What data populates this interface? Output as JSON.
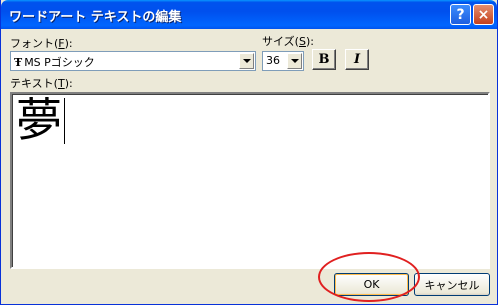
{
  "window": {
    "title": "ワードアート テキストの編集",
    "help_glyph": "?",
    "close_glyph": "×"
  },
  "font": {
    "label_prefix": "フォント(",
    "label_key": "F",
    "label_suffix": "):",
    "value": "MS Pゴシック",
    "icon_glyph": "Ŧ"
  },
  "size": {
    "label_prefix": "サイズ(",
    "label_key": "S",
    "label_suffix": "):",
    "value": "36"
  },
  "format": {
    "bold_label": "B",
    "italic_label": "I"
  },
  "text": {
    "label_prefix": "テキスト(",
    "label_key": "T",
    "label_suffix": "):",
    "value": "夢"
  },
  "buttons": {
    "ok": "OK",
    "cancel": "キャンセル"
  },
  "colors": {
    "annotation": "#e02020",
    "titlebar": "#0050ee"
  }
}
